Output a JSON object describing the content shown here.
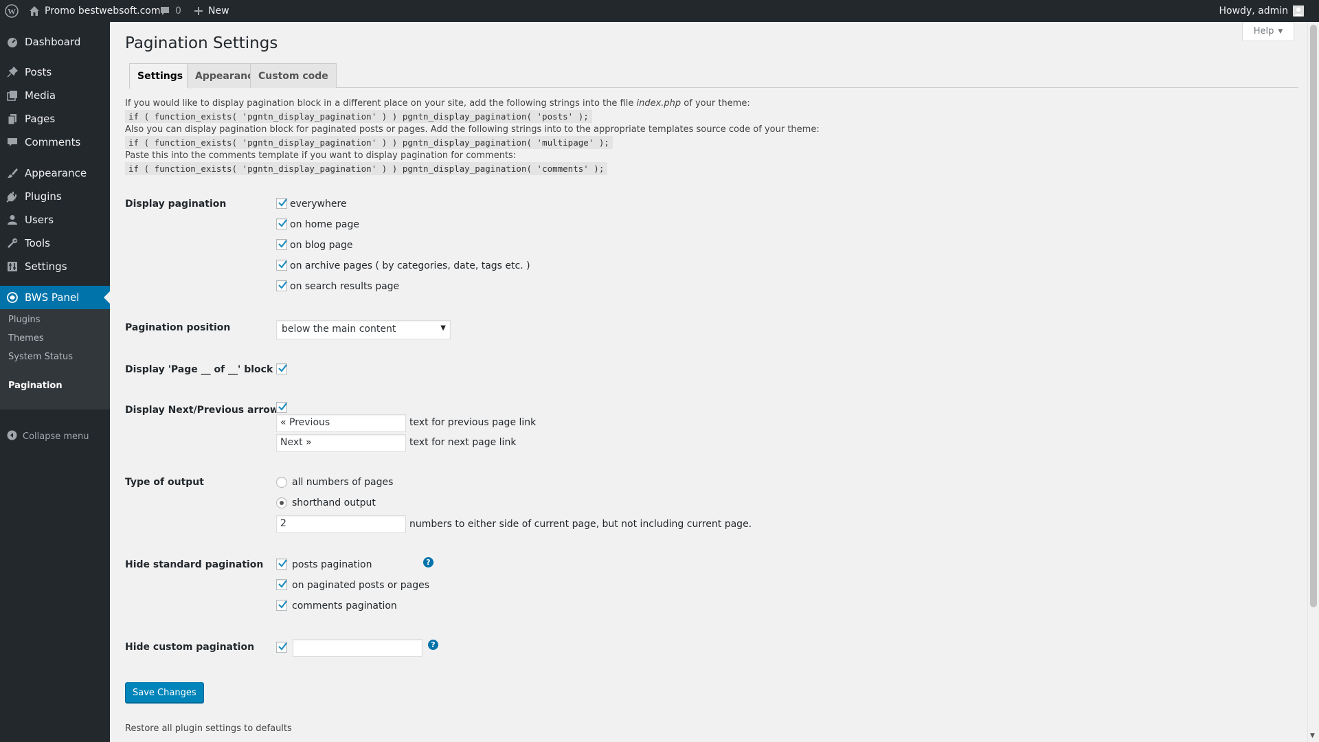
{
  "adminbar": {
    "site_name": "Promo bestwebsoft.com",
    "comments_count": "0",
    "new_label": "New",
    "howdy": "Howdy, admin"
  },
  "sidebar": {
    "items": [
      {
        "label": "Dashboard",
        "icon": "dashboard-icon"
      },
      {
        "label": "Posts",
        "icon": "pin-icon"
      },
      {
        "label": "Media",
        "icon": "media-icon"
      },
      {
        "label": "Pages",
        "icon": "pages-icon"
      },
      {
        "label": "Comments",
        "icon": "comment-icon"
      },
      {
        "label": "Appearance",
        "icon": "brush-icon"
      },
      {
        "label": "Plugins",
        "icon": "plug-icon"
      },
      {
        "label": "Users",
        "icon": "user-icon"
      },
      {
        "label": "Tools",
        "icon": "wrench-icon"
      },
      {
        "label": "Settings",
        "icon": "settings-icon"
      },
      {
        "label": "BWS Panel",
        "icon": "bws-icon"
      }
    ],
    "submenu": [
      "Plugins",
      "Themes",
      "System Status"
    ],
    "current": "Pagination",
    "collapse": "Collapse menu"
  },
  "help_label": "Help",
  "page_title": "Pagination Settings",
  "tabs": [
    "Settings",
    "Appearance",
    "Custom code"
  ],
  "intro": {
    "line1_pre": "If you would like to display pagination block in a different place on your site, add the following strings into the file ",
    "line1_file": "index.php",
    "line1_post": " of your theme:",
    "code1": "if ( function_exists( 'pgntn_display_pagination' ) ) pgntn_display_pagination( 'posts' );",
    "line2": "Also you can display pagination block for paginated posts or pages. Add the following strings into to the appropriate templates source code of your theme:",
    "code2": "if ( function_exists( 'pgntn_display_pagination' ) ) pgntn_display_pagination( 'multipage' );",
    "line3": "Paste this into the comments template if you want to display pagination for comments:",
    "code3": "if ( function_exists( 'pgntn_display_pagination' ) ) pgntn_display_pagination( 'comments' );"
  },
  "form": {
    "display_pagination": {
      "label": "Display pagination",
      "options": [
        "everywhere",
        "on home page",
        "on blog page",
        "on archive pages ( by categories, date, tags etc. )",
        "on search results page"
      ]
    },
    "position": {
      "label": "Pagination position",
      "value": "below the main content"
    },
    "page_of": {
      "label": "Display 'Page __ of __' block"
    },
    "arrows": {
      "label": "Display Next/Previous arrows",
      "prev_value": "« Previous",
      "prev_desc": "text for previous page link",
      "next_value": "Next »",
      "next_desc": "text for next page link"
    },
    "output": {
      "label": "Type of output",
      "options": [
        "all numbers of pages",
        "shorthand output"
      ],
      "numbers_value": "2",
      "numbers_desc": "numbers to either side of current page, but not including current page."
    },
    "hide_standard": {
      "label": "Hide standard pagination",
      "options": [
        "posts pagination",
        "on paginated posts or pages",
        "comments pagination"
      ]
    },
    "hide_custom": {
      "label": "Hide custom pagination",
      "value": ""
    },
    "save_label": "Save Changes",
    "restore_label": "Restore all plugin settings to defaults"
  },
  "colors": {
    "accent": "#0073aa",
    "menu_bg": "#23282d",
    "submenu_bg": "#32373c",
    "button": "#0085ba"
  }
}
